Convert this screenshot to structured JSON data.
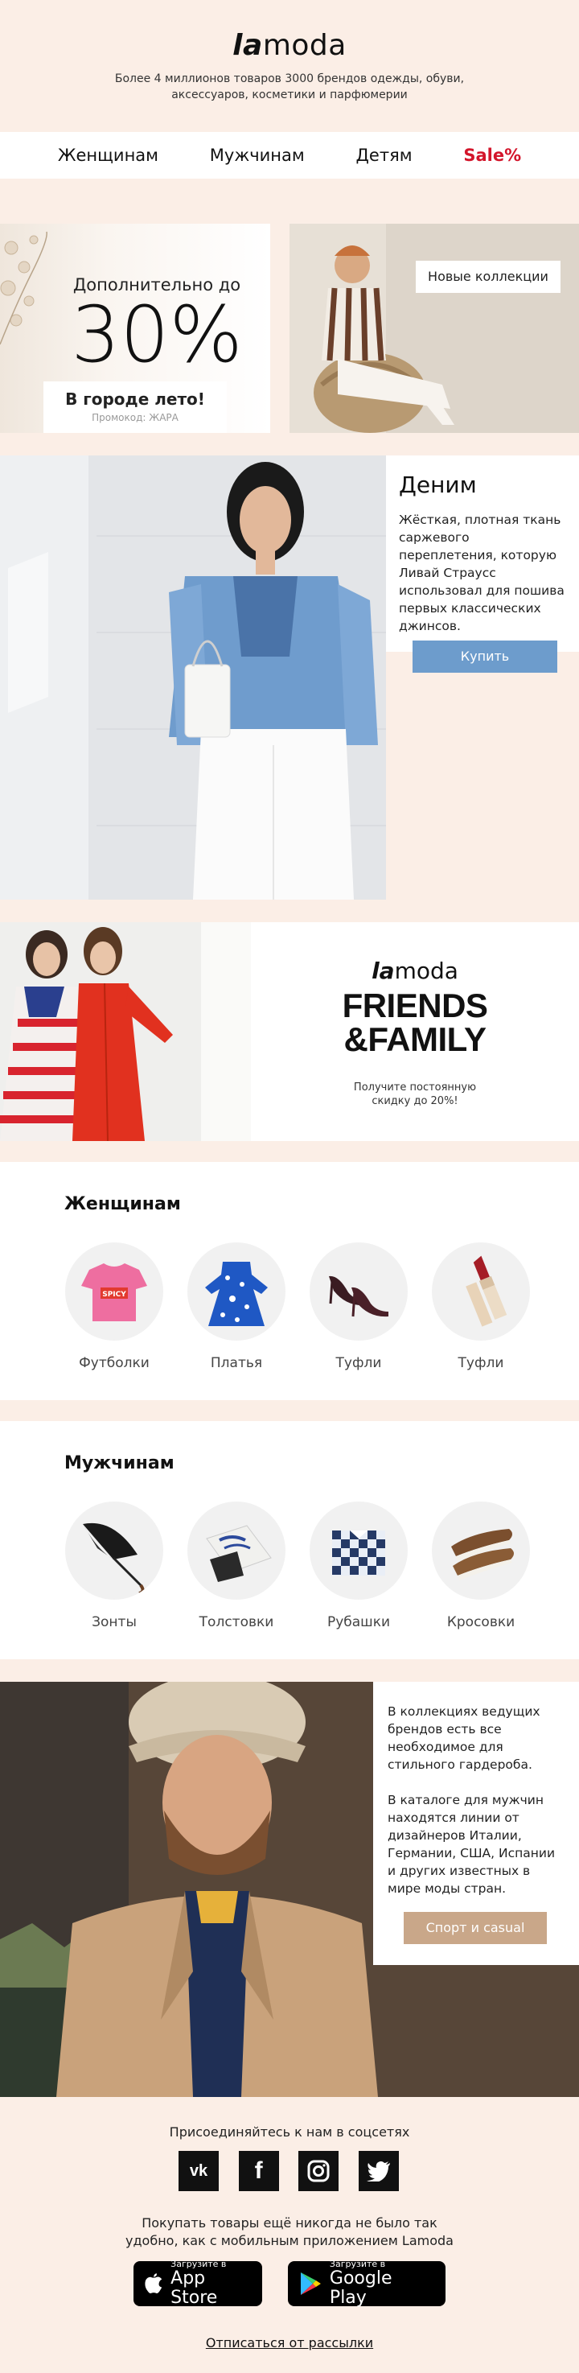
{
  "header": {
    "logo_la": "la",
    "logo_moda": "moda",
    "tagline": "Более 4 миллионов товаров 3000 брендов одежды, обуви, аксессуаров, косметики и парфюмерии"
  },
  "nav": {
    "women": "Женщинам",
    "men": "Мужчинам",
    "kids": "Детям",
    "sale": "Sale%"
  },
  "promo": {
    "subtitle": "Дополнительно до",
    "big": "30%",
    "box_title": "В городе лето!",
    "promo_code": "Промокод: ЖАРА",
    "new_collections": "Новые коллекции"
  },
  "denim": {
    "title": "Деним",
    "text": "Жёсткая, плотная ткань саржевого переплетения, которую Ливай Страусс использовал для пошива первых классических джинсов.",
    "buy": "Купить"
  },
  "friends": {
    "logo_la": "la",
    "logo_moda": "moda",
    "title_line1": "FRIENDS",
    "title_line2": "&FAMILY",
    "text": "Получите постоянную скидку до 20%!"
  },
  "women": {
    "title": "Женщинам",
    "items": [
      {
        "label": "Футболки"
      },
      {
        "label": "Платья"
      },
      {
        "label": "Туфли"
      },
      {
        "label": "Туфли"
      }
    ],
    "tshirt_print": "SPICY"
  },
  "men": {
    "title": "Мужчинам",
    "items": [
      {
        "label": "Зонты"
      },
      {
        "label": "Толстовки"
      },
      {
        "label": "Рубашки"
      },
      {
        "label": "Кросовки"
      }
    ]
  },
  "men_promo": {
    "p1": "В коллекциях ведущих брендов есть все необходимое для стильного гардероба.",
    "p2": "В каталоге для мужчин находятся линии от дизайнеров Италии, Германии, США, Испании и других известных в мире моды стран.",
    "button": "Спорт и casual"
  },
  "footer": {
    "social_title": "Присоединяйтесь к нам в соцсетях",
    "social": {
      "vk": "vk",
      "fb": "f",
      "tw": "t"
    },
    "app_text": "Покупать товары ещё никогда не было так удобно, как с мобильным приложением Lamoda",
    "appstore_small": "Загрузите в",
    "appstore_big": "App Store",
    "google_small": "Загрузите в",
    "google_big": "Google Play",
    "unsubscribe": "Отписаться от рассылки"
  },
  "colors": {
    "background": "#fbeee6",
    "sale": "#d3152b",
    "buy_button": "#6d9ccc",
    "casual_button": "#c9a789"
  }
}
